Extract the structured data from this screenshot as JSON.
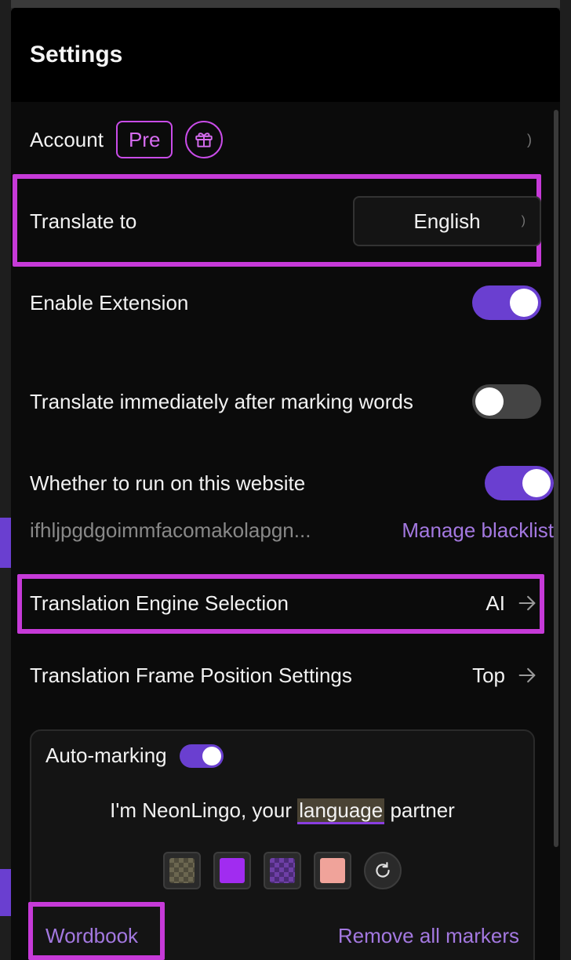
{
  "header": {
    "title": "Settings"
  },
  "account": {
    "label": "Account",
    "badge": "Pre",
    "gift_icon": "gift-icon",
    "chevron": ")"
  },
  "translate_to": {
    "label": "Translate to",
    "value": "English",
    "chevron": ")"
  },
  "enable_extension": {
    "label": "Enable Extension",
    "enabled": true
  },
  "translate_immediately": {
    "label": "Translate immediately after marking words",
    "enabled": false
  },
  "run_on_site": {
    "label": "Whether to run on this website",
    "enabled": true,
    "site_id": "ifhljpgdgoimmfacomakolapgn...",
    "manage_link": "Manage blacklist"
  },
  "engine": {
    "label": "Translation Engine Selection",
    "value": "AI",
    "arrow_icon": "arrow-right-icon"
  },
  "frame_position": {
    "label": "Translation Frame Position Settings",
    "value": "Top",
    "arrow_icon": "arrow-right-icon"
  },
  "auto_marking": {
    "label": "Auto-marking",
    "enabled": true,
    "sample_before": "I'm NeonLingo, your ",
    "sample_highlight": "language",
    "sample_after": " partner",
    "swatches": [
      "checkered-olive",
      "purple",
      "checkered-violet",
      "salmon"
    ],
    "reset_icon": "refresh-icon",
    "wordbook_link": "Wordbook",
    "remove_link": "Remove all markers"
  },
  "colors": {
    "accent": "#6a3fd0",
    "highlight_border": "#c63ad8",
    "link": "#a378e0",
    "badge": "#c94ce8"
  }
}
